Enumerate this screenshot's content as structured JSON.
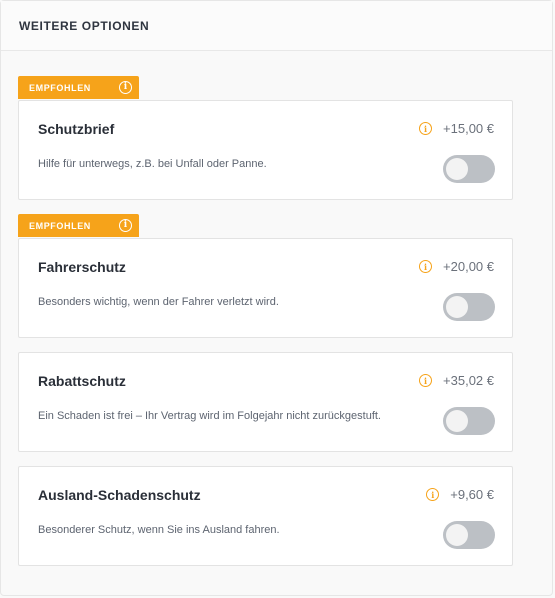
{
  "header": {
    "title": "WEITERE OPTIONEN"
  },
  "options": [
    {
      "badge": "EMPFOHLEN",
      "title": "Schutzbrief",
      "price": "+15,00 €",
      "description": "Hilfe für unterwegs, z.B. bei Unfall oder Panne.",
      "enabled": false
    },
    {
      "badge": "EMPFOHLEN",
      "title": "Fahrerschutz",
      "price": "+20,00 €",
      "description": "Besonders wichtig, wenn der Fahrer verletzt wird.",
      "enabled": false
    },
    {
      "badge": "",
      "title": "Rabattschutz",
      "price": "+35,02 €",
      "description": "Ein Schaden ist frei – Ihr Vertrag wird im Folgejahr nicht zurückgestuft.",
      "enabled": false
    },
    {
      "badge": "",
      "title": "Ausland-Schadenschutz",
      "price": "+9,60 €",
      "description": "Besonderer Schutz, wenn Sie ins Ausland fahren.",
      "enabled": false
    }
  ],
  "colors": {
    "accent": "#f6a31a",
    "toggle_off": "#bcc0c5"
  },
  "icons": {
    "info": "info-circle-icon"
  }
}
